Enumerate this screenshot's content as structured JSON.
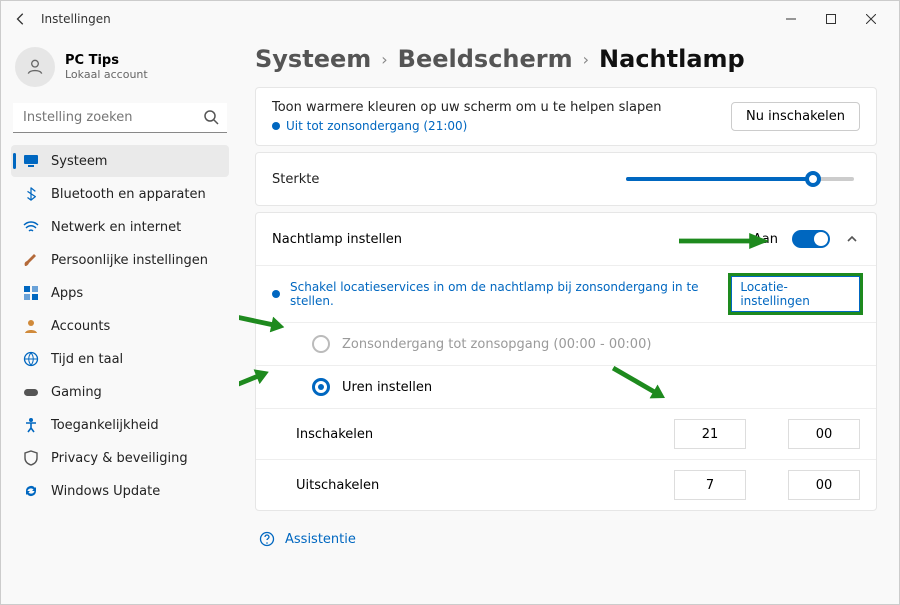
{
  "window": {
    "title": "Instellingen"
  },
  "user": {
    "name": "PC Tips",
    "sub": "Lokaal account"
  },
  "search": {
    "placeholder": "Instelling zoeken"
  },
  "nav": {
    "items": [
      {
        "icon": "monitor",
        "label": "Systeem",
        "active": true
      },
      {
        "icon": "bluetooth",
        "label": "Bluetooth en apparaten"
      },
      {
        "icon": "wifi",
        "label": "Netwerk en internet"
      },
      {
        "icon": "brush",
        "label": "Persoonlijke instellingen"
      },
      {
        "icon": "apps",
        "label": "Apps"
      },
      {
        "icon": "person",
        "label": "Accounts"
      },
      {
        "icon": "globe",
        "label": "Tijd en taal"
      },
      {
        "icon": "gamepad",
        "label": "Gaming"
      },
      {
        "icon": "accessibility",
        "label": "Toegankelijkheid"
      },
      {
        "icon": "shield",
        "label": "Privacy & beveiliging"
      },
      {
        "icon": "update",
        "label": "Windows Update"
      }
    ]
  },
  "breadcrumb": {
    "a": "Systeem",
    "b": "Beeldscherm",
    "c": "Nachtlamp"
  },
  "header": {
    "desc": "Toon warmere kleuren op uw scherm om u te helpen slapen",
    "status": "Uit tot zonsondergang (21:00)",
    "enable_btn": "Nu inschakelen"
  },
  "strength": {
    "label": "Sterkte",
    "value_pct": 82
  },
  "schedule": {
    "label": "Nachtlamp instellen",
    "state_text": "Aan",
    "info": "Schakel locatieservices in om de nachtlamp bij zonsondergang in te stellen.",
    "link": "Locatie-instellingen",
    "opt_sunset": "Zonsondergang tot zonsopgang (00:00 - 00:00)",
    "opt_hours": "Uren instellen",
    "turn_on_label": "Inschakelen",
    "turn_on_h": "21",
    "turn_on_m": "00",
    "turn_off_label": "Uitschakelen",
    "turn_off_h": "7",
    "turn_off_m": "00"
  },
  "assist": "Assistentie",
  "colors": {
    "accent": "#0067c0",
    "annotation": "#1e8a1e"
  }
}
